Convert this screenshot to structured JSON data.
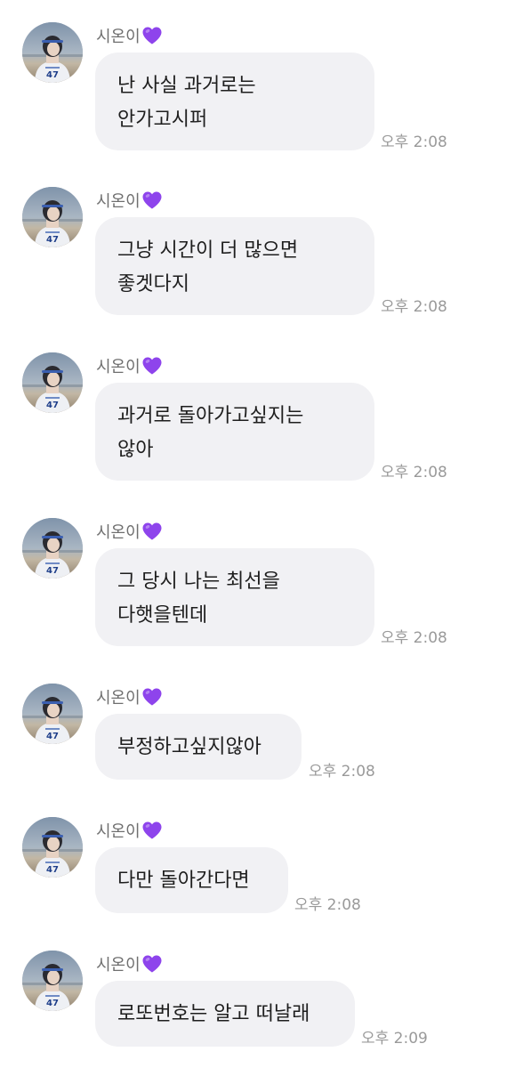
{
  "sender_name": "시온이",
  "heart_icon": "purple-heart-icon",
  "heart_color": "#8e44ec",
  "bubble_color": "#f1f1f4",
  "messages": [
    {
      "text": "난 사실 과거로는\n안가고시퍼",
      "time": "오후 2:08"
    },
    {
      "text": "그냥 시간이 더 많으면\n좋겟다지",
      "time": "오후 2:08"
    },
    {
      "text": "과거로 돌아가고싶지는\n않아",
      "time": "오후 2:08"
    },
    {
      "text": "그 당시 나는 최선을\n다햇을텐데",
      "time": "오후 2:08"
    },
    {
      "text": "부정하고싶지않아",
      "time": "오후 2:08"
    },
    {
      "text": "다만 돌아간다면",
      "time": "오후 2:08"
    },
    {
      "text": "로또번호는 알고 떠날래",
      "time": "오후 2:09"
    }
  ]
}
